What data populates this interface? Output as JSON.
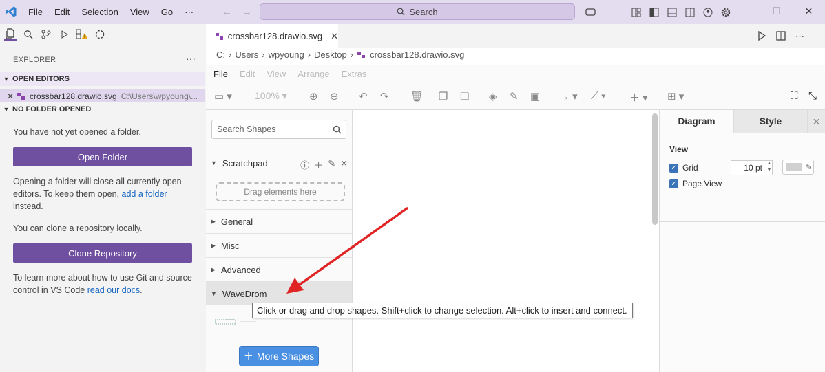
{
  "titlebar": {
    "menu": [
      "File",
      "Edit",
      "Selection",
      "View",
      "Go",
      "···"
    ],
    "search_label": "Search"
  },
  "sidebar": {
    "title": "EXPLORER",
    "more": "···",
    "open_editors_label": "OPEN EDITORS",
    "open_file_name": "crossbar128.drawio.svg",
    "open_file_path": "C:\\Users\\wpyoung\\...",
    "no_folder_label": "NO FOLDER OPENED",
    "msg1": "You have not yet opened a folder.",
    "open_folder_btn": "Open Folder",
    "msg2_a": "Opening a folder will close all currently open editors. To keep them open,",
    "msg2_link": "add a folder",
    "msg2_b": "instead.",
    "msg3": "You can clone a repository locally.",
    "clone_btn": "Clone Repository",
    "msg4_a": "To learn more about how to use Git and source control in VS Code",
    "msg4_link": "read our docs",
    "msg4_b": "."
  },
  "editor": {
    "tab_label": "crossbar128.drawio.svg",
    "breadcrumb": [
      "C:",
      "Users",
      "wpyoung",
      "Desktop",
      "crossbar128.drawio.svg"
    ]
  },
  "drawio": {
    "menu": [
      "File",
      "Edit",
      "View",
      "Arrange",
      "Extras"
    ],
    "zoom": "100%",
    "search_placeholder": "Search Shapes",
    "sections": {
      "scratchpad": "Scratchpad",
      "dropzone": "Drag elements here",
      "general": "General",
      "misc": "Misc",
      "advanced": "Advanced",
      "wavedrom": "WaveDrom"
    },
    "more_shapes": "More Shapes",
    "format": {
      "tab_diagram": "Diagram",
      "tab_style": "Style",
      "view_label": "View",
      "grid_label": "Grid",
      "grid_size": "10 pt",
      "page_view_label": "Page View"
    },
    "tooltip": "Click or drag and drop shapes. Shift+click to change selection. Alt+click to insert and connect."
  },
  "colors": {
    "accent": "#6f4fa0",
    "titlebar": "#e4dcef",
    "more_shapes_btn": "#4a90e2",
    "arrow": "#e02424"
  }
}
